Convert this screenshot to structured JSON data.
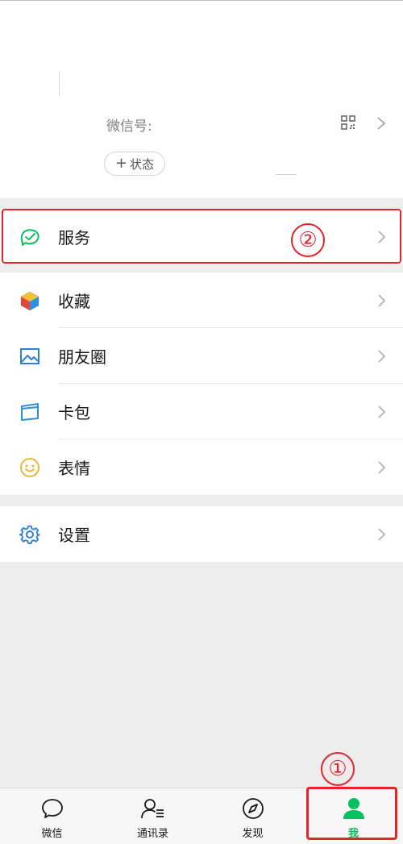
{
  "profile": {
    "wechat_id_label": "微信号:",
    "status_label": "状态",
    "status_plus": "+"
  },
  "menu": {
    "services": {
      "label": "服务",
      "icon": "services-icon"
    },
    "favorites": {
      "label": "收藏",
      "icon": "favorites-icon"
    },
    "moments": {
      "label": "朋友圈",
      "icon": "moments-icon"
    },
    "cards": {
      "label": "卡包",
      "icon": "card-wallet-icon"
    },
    "stickers": {
      "label": "表情",
      "icon": "sticker-icon"
    },
    "settings": {
      "label": "设置",
      "icon": "settings-icon"
    }
  },
  "annotations": {
    "marker_1": "①",
    "marker_2": "②",
    "color": "#e0262a"
  },
  "tabbar": {
    "tabs": [
      {
        "label": "微信",
        "icon": "chat-icon",
        "active": false
      },
      {
        "label": "通讯录",
        "icon": "contacts-icon",
        "active": false
      },
      {
        "label": "发现",
        "icon": "discover-compass-icon",
        "active": false
      },
      {
        "label": "我",
        "icon": "me-person-icon",
        "active": true
      }
    ]
  },
  "colors": {
    "accent_green": "#07c160",
    "background": "#ededed"
  }
}
